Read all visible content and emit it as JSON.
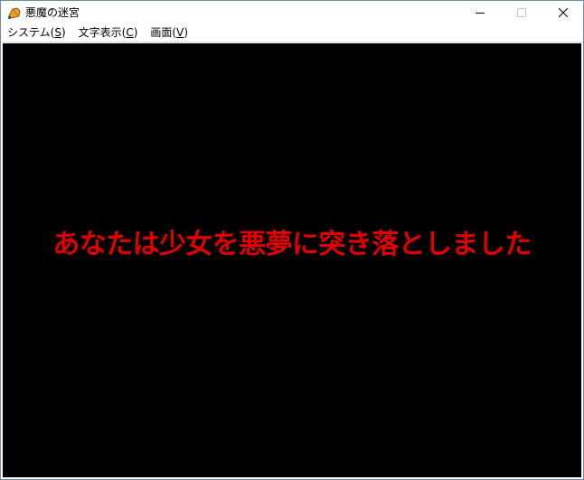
{
  "window": {
    "title": "悪魔の迷宮",
    "icon": "app-game-icon"
  },
  "menu": [
    {
      "label": "システム(",
      "accel": "S",
      "suffix": ")"
    },
    {
      "label": "文字表示(",
      "accel": "C",
      "suffix": ")"
    },
    {
      "label": "画面(",
      "accel": "V",
      "suffix": ")"
    }
  ],
  "game": {
    "background": "#000000",
    "message": "あなたは少女を悪夢に突き落としました",
    "message_color": "#e00000"
  }
}
